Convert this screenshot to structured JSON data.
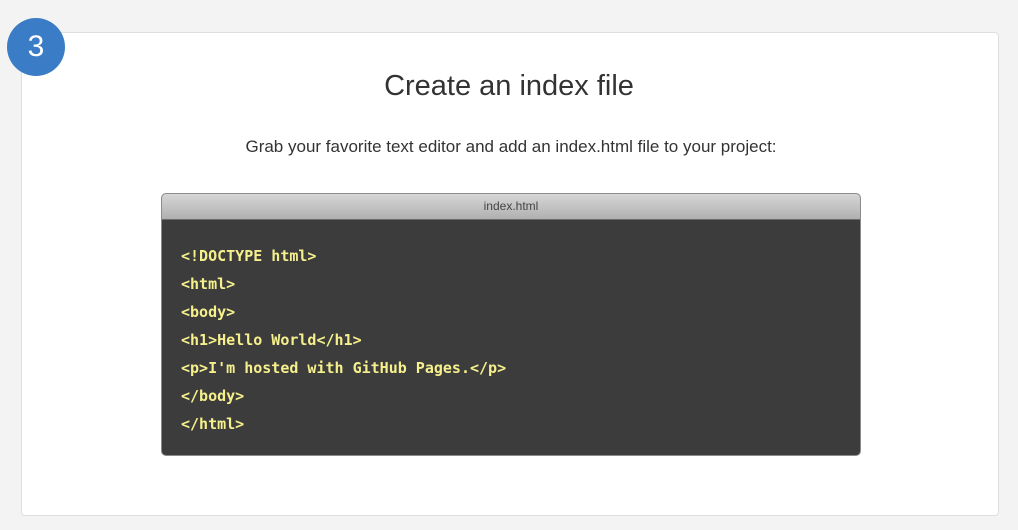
{
  "step": {
    "number": "3"
  },
  "section": {
    "title": "Create an index file",
    "description": "Grab your favorite text editor and add an index.html file to your project:"
  },
  "code_window": {
    "filename": "index.html",
    "lines": [
      "<!DOCTYPE html>",
      "<html>",
      "<body>",
      "<h1>Hello World</h1>",
      "<p>I'm hosted with GitHub Pages.</p>",
      "</body>",
      "</html>"
    ]
  },
  "colors": {
    "badge": "#3a7dc6",
    "code_background": "#3c3c3c",
    "code_text": "#f6f08c"
  }
}
